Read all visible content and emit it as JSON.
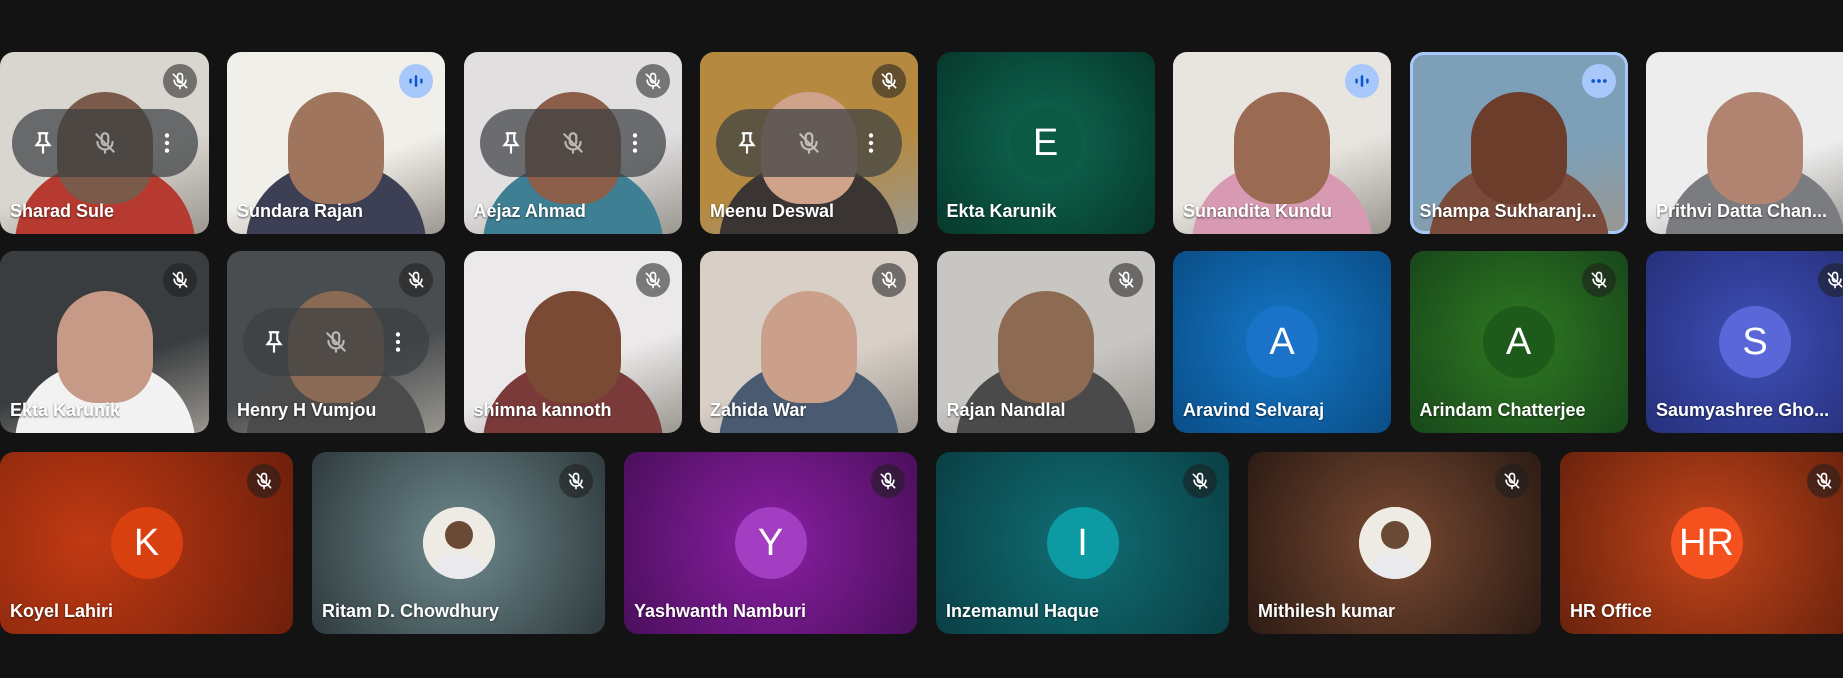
{
  "participants": [
    {
      "name": "Sharad Sule",
      "status": "muted",
      "overlay": true
    },
    {
      "name": "Sundara Rajan",
      "status": "speaking"
    },
    {
      "name": "Aejaz Ahmad",
      "status": "muted",
      "overlay": true
    },
    {
      "name": "Meenu Deswal",
      "status": "muted",
      "overlay": true
    },
    {
      "name": "Ekta Karunik",
      "status": "none",
      "initial": "E",
      "avatar_color": "#0b5a44"
    },
    {
      "name": "Sunandita Kundu",
      "status": "speaking"
    },
    {
      "name": "Shampa Sukharanj...",
      "status": "more",
      "active": true
    },
    {
      "name": "Prithvi Datta Chan...",
      "status": "none"
    },
    {
      "name": "Ekta Karunik",
      "status": "muted"
    },
    {
      "name": "Henry H Vumjou",
      "status": "muted",
      "overlay": true
    },
    {
      "name": "shimna kannoth",
      "status": "muted"
    },
    {
      "name": "Zahida War",
      "status": "muted"
    },
    {
      "name": "Rajan Nandlal",
      "status": "muted"
    },
    {
      "name": "Aravind Selvaraj",
      "status": "none",
      "initial": "A",
      "avatar_color": "#1a73c8"
    },
    {
      "name": "Arindam Chatterjee",
      "status": "muted",
      "initial": "A",
      "avatar_color": "#1e5b1a"
    },
    {
      "name": "Saumyashree Gho...",
      "status": "muted",
      "initial": "S",
      "avatar_color": "#5a67d8"
    },
    {
      "name": "Koyel Lahiri",
      "status": "muted",
      "initial": "K",
      "avatar_color": "#d8400f"
    },
    {
      "name": "Ritam D. Chowdhury",
      "status": "muted",
      "photo_avatar": true
    },
    {
      "name": "Yashwanth Namburi",
      "status": "muted",
      "initial": "Y",
      "avatar_color": "#a33dc1"
    },
    {
      "name": "Inzemamul Haque",
      "status": "muted",
      "initial": "I",
      "avatar_color": "#0e9aa3"
    },
    {
      "name": "Mithilesh kumar",
      "status": "muted",
      "photo_avatar": true
    },
    {
      "name": "HR Office",
      "status": "muted",
      "initial": "HR",
      "avatar_color": "#f4511e"
    }
  ],
  "icons": {
    "muted": "mic-off-icon",
    "speaking": "audio-level-icon",
    "more": "more-options-icon",
    "pin": "pin-icon"
  },
  "colors": {
    "background": "#131313",
    "active_outline": "#a8c7fa",
    "speaking_badge": "#a8c7fa"
  }
}
